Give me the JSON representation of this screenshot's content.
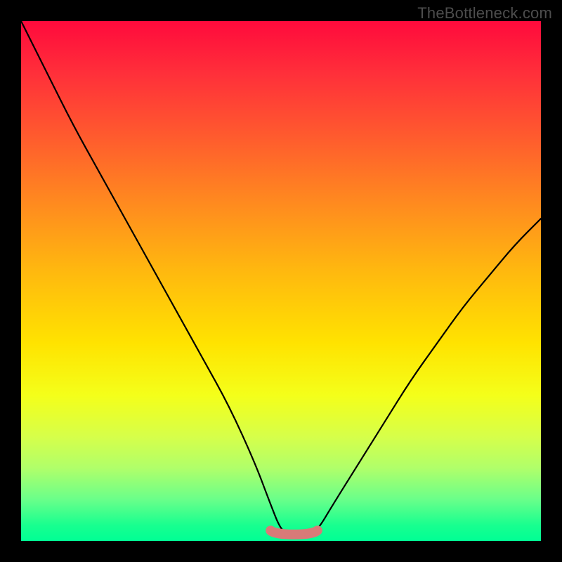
{
  "watermark": "TheBottleneck.com",
  "chart_data": {
    "type": "line",
    "title": "",
    "xlabel": "",
    "ylabel": "",
    "xlim": [
      0,
      100
    ],
    "ylim": [
      0,
      100
    ],
    "series": [
      {
        "name": "bottleneck-curve",
        "x": [
          0,
          5,
          10,
          15,
          20,
          25,
          30,
          35,
          40,
          45,
          48,
          50,
          52,
          55,
          57,
          60,
          65,
          70,
          75,
          80,
          85,
          90,
          95,
          100
        ],
        "values": [
          100,
          90,
          80,
          71,
          62,
          53,
          44,
          35,
          26,
          15,
          7,
          2,
          1,
          1,
          2,
          7,
          15,
          23,
          31,
          38,
          45,
          51,
          57,
          62
        ]
      }
    ],
    "flat_segment": {
      "x_start": 48,
      "x_end": 57,
      "y": 2
    },
    "curve_color": "#000000",
    "flat_segment_color": "#d87a78"
  }
}
